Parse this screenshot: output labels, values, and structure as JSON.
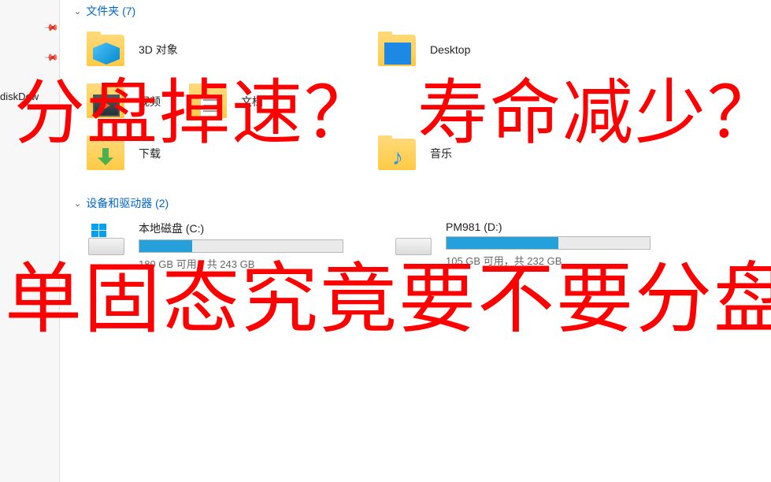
{
  "sidebar": {
    "pinned_item": "diskDow"
  },
  "sections": {
    "folders": {
      "label": "文件夹 (7)"
    },
    "drives": {
      "label": "设备和驱动器 (2)"
    }
  },
  "folders": [
    {
      "label": "3D 对象",
      "overlay": "cube"
    },
    {
      "label": "Desktop",
      "overlay": "desktop"
    },
    {
      "label": "视频",
      "overlay": "video"
    },
    {
      "label": "文档",
      "overlay": "doc"
    },
    {
      "label": "下载",
      "overlay": "download"
    },
    {
      "label": "音乐",
      "overlay": "music"
    }
  ],
  "drives": [
    {
      "name": "本地磁盘 (C:)",
      "free": "180 GB 可用，共 243 GB",
      "fill_pct": 26,
      "windows": true
    },
    {
      "name": "PM981 (D:)",
      "free": "105 GB 可用，共 232 GB",
      "fill_pct": 55,
      "windows": false
    }
  ],
  "overlays": {
    "q1": "分盘掉速？",
    "q2": "寿命减少？",
    "q3": "单固态究竟要不要分盘？"
  }
}
